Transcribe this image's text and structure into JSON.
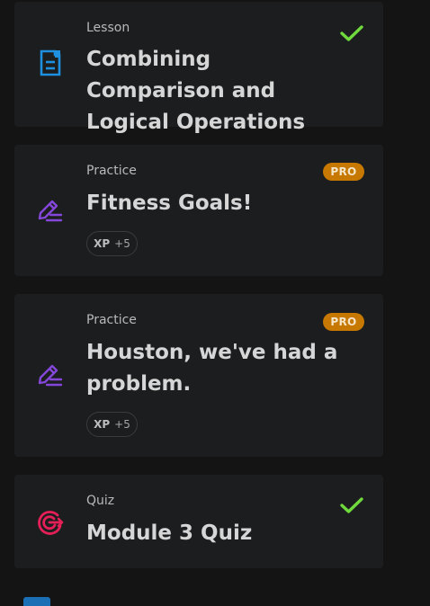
{
  "items": [
    {
      "type": "Lesson",
      "title": "Combining Comparison and Logical Operations",
      "status_icon": "check-icon",
      "icon": "lesson-document-icon"
    },
    {
      "type": "Practice",
      "title": "Fitness Goals!",
      "badge": "PRO",
      "xp_label": "XP",
      "xp_value": "+5",
      "icon": "practice-pencil-icon"
    },
    {
      "type": "Practice",
      "title": "Houston, we've had a problem.",
      "badge": "PRO",
      "xp_label": "XP",
      "xp_value": "+5",
      "icon": "practice-pencil-icon"
    },
    {
      "type": "Quiz",
      "title": "Module 3 Quiz",
      "status_icon": "check-icon",
      "icon": "quiz-target-icon"
    }
  ],
  "colors": {
    "lesson_icon": "#1f8fe0",
    "practice_icon": "#8447d9",
    "quiz_icon": "#e51f57",
    "check": "#6fd93d",
    "pro_badge": "#c67800"
  }
}
